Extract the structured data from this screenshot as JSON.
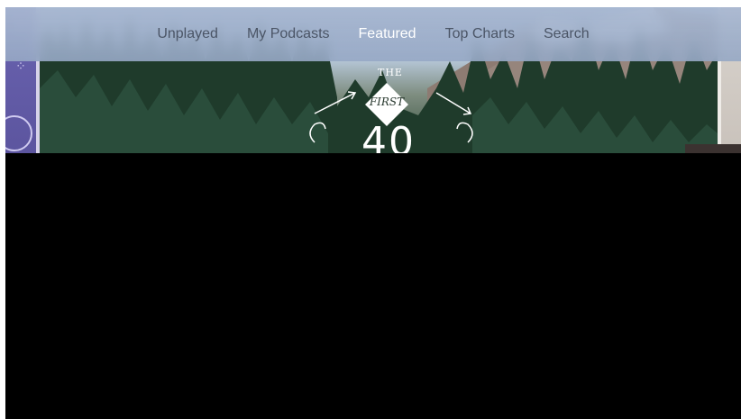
{
  "nav": {
    "items": [
      {
        "label": "Unplayed",
        "active": false
      },
      {
        "label": "My Podcasts",
        "active": false
      },
      {
        "label": "Featured",
        "active": true
      },
      {
        "label": "Top Charts",
        "active": false
      },
      {
        "label": "Search",
        "active": false
      }
    ]
  },
  "featured": {
    "art_the": "THE",
    "art_first": "FIRST",
    "art_number": "40"
  },
  "colors": {
    "nav_text": "#4b5566",
    "nav_active": "#ffffff",
    "background": "#000000",
    "left_tile": "#6a63b0"
  },
  "icons": [
    "puzzle-ornament-icon",
    "circle-ornament-icon",
    "arrow-left-icon",
    "arrow-right-icon"
  ]
}
